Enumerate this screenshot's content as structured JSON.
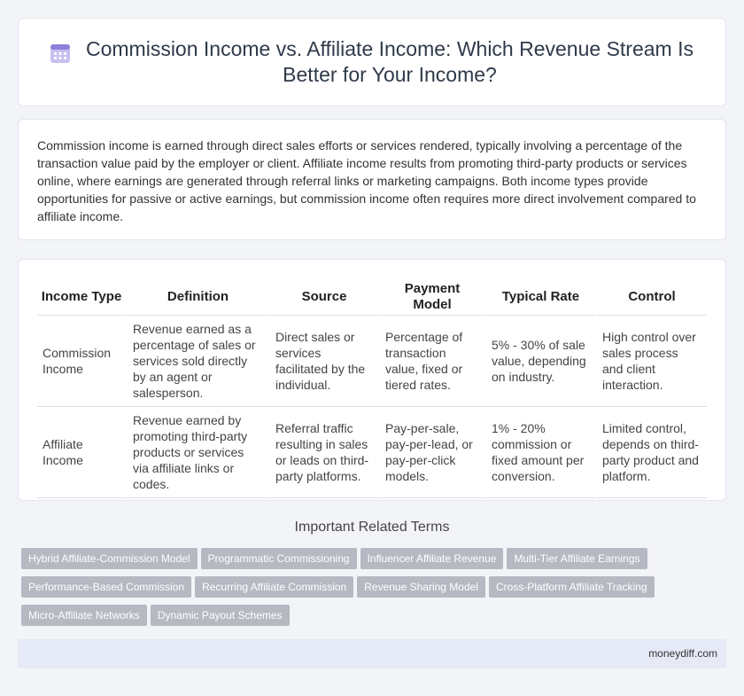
{
  "header": {
    "title": "Commission Income vs. Affiliate Income: Which Revenue Stream Is Better for Your Income?",
    "icon": "calendar-icon"
  },
  "intro": {
    "text": "Commission income is earned through direct sales efforts or services rendered, typically involving a percentage of the transaction value paid by the employer or client. Affiliate income results from promoting third-party products or services online, where earnings are generated through referral links or marketing campaigns. Both income types provide opportunities for passive or active earnings, but commission income often requires more direct involvement compared to affiliate income."
  },
  "table": {
    "headers": [
      "Income Type",
      "Definition",
      "Source",
      "Payment Model",
      "Typical Rate",
      "Control"
    ],
    "rows": [
      [
        "Commission Income",
        "Revenue earned as a percentage of sales or services sold directly by an agent or salesperson.",
        "Direct sales or services facilitated by the individual.",
        "Percentage of transaction value, fixed or tiered rates.",
        "5% - 30% of sale value, depending on industry.",
        "High control over sales process and client interaction."
      ],
      [
        "Affiliate Income",
        "Revenue earned by promoting third-party products or services via affiliate links or codes.",
        "Referral traffic resulting in sales or leads on third-party platforms.",
        "Pay-per-sale, pay-per-lead, or pay-per-click models.",
        "1% - 20% commission or fixed amount per conversion.",
        "Limited control, depends on third-party product and platform."
      ]
    ]
  },
  "related": {
    "title": "Important Related Terms",
    "tags": [
      "Hybrid Affiliate-Commission Model",
      "Programmatic Commissioning",
      "Influencer Affiliate Revenue",
      "Multi-Tier Affiliate Earnings",
      "Performance-Based Commission",
      "Recurring Affiliate Commission",
      "Revenue Sharing Model",
      "Cross-Platform Affiliate Tracking",
      "Micro-Affiliate Networks",
      "Dynamic Payout Schemes"
    ]
  },
  "footer": {
    "site": "moneydiff.com"
  },
  "colors": {
    "background": "#f3f4f8",
    "tag": "#b5b9c2",
    "footer": "#e6eaf6",
    "icon": "#9b8ad6"
  }
}
